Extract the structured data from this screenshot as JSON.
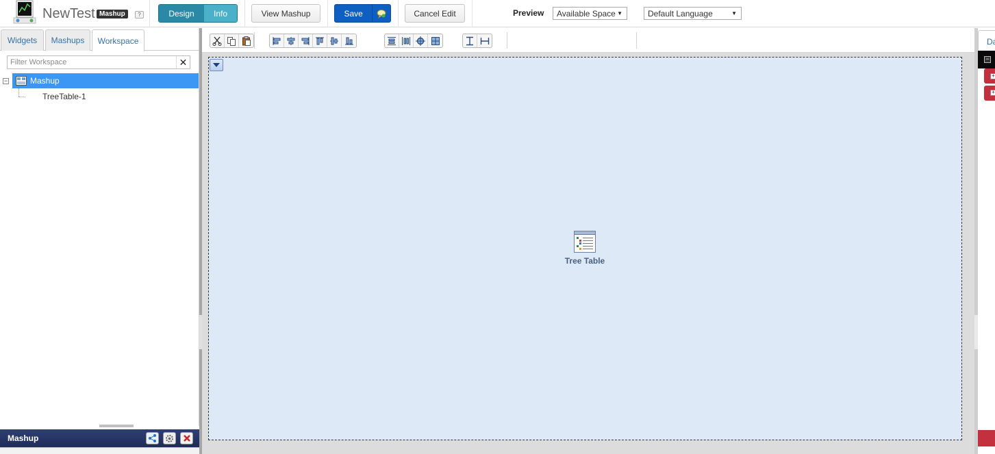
{
  "header": {
    "title": "NewTest",
    "type_badge": "Mashup",
    "help_badge": "?",
    "mode_tabs": [
      {
        "label": "Design",
        "active": true
      },
      {
        "label": "Info",
        "active": false
      }
    ],
    "view_button": "View Mashup",
    "save_button": "Save",
    "cancel_button": "Cancel Edit"
  },
  "left_panel": {
    "tabs": [
      {
        "label": "Widgets",
        "active": false
      },
      {
        "label": "Mashups",
        "active": false
      },
      {
        "label": "Workspace",
        "active": true
      }
    ],
    "filter": {
      "placeholder": "Filter Workspace",
      "value": "",
      "clear_icon": "close-icon"
    },
    "tree": {
      "root": {
        "label": "Mashup",
        "expanded": true,
        "icon": "mashup-icon",
        "selected": true
      },
      "children": [
        {
          "label": "TreeTable-1"
        }
      ],
      "toggle_glyph": "−"
    }
  },
  "properties_panel": {
    "title": "Mashup",
    "buttons": [
      "share-icon",
      "gear-icon",
      "close-icon"
    ]
  },
  "toolbar": {
    "preview_label": "Preview",
    "preview_select": {
      "value": "Available Space"
    },
    "language_select": {
      "value": "Default Language"
    },
    "groups": [
      [
        "cut-icon",
        "copy-icon",
        "paste-icon"
      ],
      [
        "align-left-icon",
        "align-center-icon",
        "align-right-icon",
        "align-top-icon",
        "align-middle-icon",
        "align-bottom-icon"
      ],
      [
        "distribute-vertical-icon",
        "distribute-horizontal-icon",
        "center-icon",
        "grid-icon"
      ],
      [
        "same-height-icon",
        "same-width-icon"
      ]
    ]
  },
  "canvas": {
    "widget": {
      "label": "Tree Table",
      "icon": "tree-table-icon"
    }
  },
  "right_panel": {
    "tab_label": "Da",
    "collapse_glyph": "−",
    "expand_glyph": "+"
  },
  "colors": {
    "design_tab": "#2a8aa6",
    "info_tab": "#4bb1c9",
    "save_button": "#0e5fc1",
    "tree_selected": "#3c96f3",
    "canvas_bg": "#dde9f6",
    "props_header": "#1f2c5a",
    "right_accent": "#c2313d"
  }
}
